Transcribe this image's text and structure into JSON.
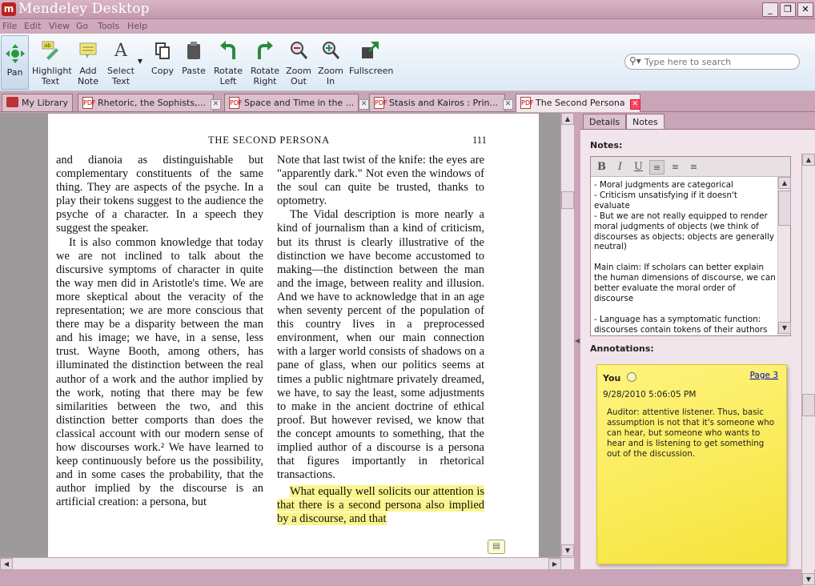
{
  "window": {
    "title": "Mendeley Desktop",
    "controls": [
      "_",
      "❐",
      "✕"
    ]
  },
  "menu": [
    "File",
    "Edit",
    "View",
    "Go",
    "Tools",
    "Help"
  ],
  "toolbar": {
    "pan": "Pan",
    "highlight": [
      "Highlight",
      "Text"
    ],
    "add_note": [
      "Add",
      "Note"
    ],
    "select_text": [
      "Select",
      "Text"
    ],
    "copy": "Copy",
    "paste": "Paste",
    "rotate_left": [
      "Rotate",
      "Left"
    ],
    "rotate_right": [
      "Rotate",
      "Right"
    ],
    "zoom_out": [
      "Zoom",
      "Out"
    ],
    "zoom_in": [
      "Zoom",
      "In"
    ],
    "fullscreen": "Fullscreen"
  },
  "search": {
    "placeholder": "Type here to search"
  },
  "tabs": [
    {
      "label": "My Library"
    },
    {
      "label": "Rhetoric, the Sophists,..."
    },
    {
      "label": "Space and Time in the ..."
    },
    {
      "label": "Stasis and Kairos : Prin..."
    },
    {
      "label": "The Second Persona"
    }
  ],
  "document": {
    "header": "THE SECOND PERSONA",
    "page_number": "111",
    "left_column": [
      "and dianoia as distinguishable but complementary constituents of the same thing. They are aspects of the psyche. In a play their tokens suggest to the audience the psyche of a character. In a speech they suggest the speaker.",
      "It is also common knowledge that today we are not inclined to talk about the discursive symptoms of character in quite the way men did in Aristotle's time. We are more skeptical about the veracity of the representation; we are more conscious that there may be a disparity between the man and his image; we have, in a sense, less trust. Wayne Booth, among others, has illuminated the distinction between the real author of a work and the author implied by the work, noting that there may be few similarities between the two, and this distinction better comports than does the classical account with our modern sense of how discourses work.² We have learned to keep continuously before us the possibility, and in some cases the probability, that the author implied by the discourse is an artificial creation: a persona, but"
    ],
    "right_column": [
      "Note that last twist of the knife: the eyes are \"apparently dark.\" Not even the windows of the soul can quite be trusted, thanks to optometry.",
      "The Vidal description is more nearly a kind of journalism than a kind of criticism, but its thrust is clearly illustrative of the distinction we have become accustomed to making—the distinction between the man and the image, between reality and illusion. And we have to acknowledge that in an age when seventy percent of the population of this country lives in a preprocessed environment, when our main connection with a larger world consists of shadows on a pane of glass, when our politics seems at times a public nightmare privately dreamed, we have, to say the least, some adjustments to make in the ancient doctrine of ethical proof. But however revised, we know that the concept amounts to something, that the implied author of a discourse is a persona that figures importantly in rhetorical transactions."
    ],
    "highlighted": "What equally well solicits our attention is that there is a second persona also implied by a discourse, and that"
  },
  "panel": {
    "tabs": [
      "Details",
      "Notes"
    ],
    "notes_label": "Notes:",
    "notes_text": "- Moral judgments are categorical\n- Criticism unsatisfying if it doesn't evaluate\n- But we are not really equipped to render moral judgments of objects (we think of discourses as objects; objects are generally neutral)\n\nMain claim: If scholars can better explain the human dimensions of discourse, we can better evaluate the moral order of discourse\n\n- Language has a symptomatic function: discourses contain tokens of their authors\n- Discourse reveals two dimensions of character: moral and intellectual",
    "annotations_label": "Annotations:",
    "annotation": {
      "author": "You",
      "page_link": "Page 3",
      "datetime": "9/28/2010 5:06:05 PM",
      "text": "Auditor: attentive listener. Thus, basic assumption is not that it's someone who can hear, but someone who wants to hear and is listening to get something out of the discussion."
    }
  },
  "colors": {
    "chrome": "#c9a5b7",
    "toolbar": "#e8f0f8",
    "highlight": "#fbf58c",
    "sticky": "#f8ea55",
    "link": "#0000cc"
  }
}
